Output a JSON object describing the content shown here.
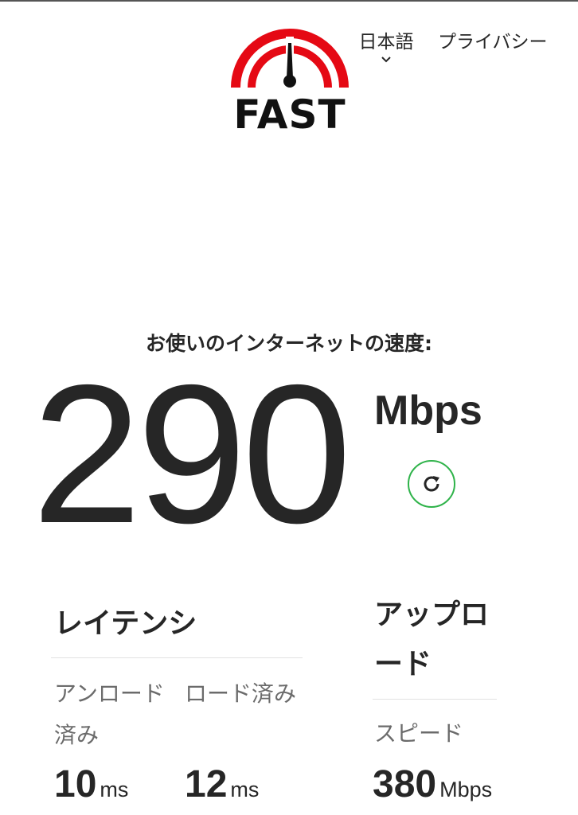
{
  "brand": {
    "logo_text": "FAST",
    "colors": {
      "accent_red": "#e50914",
      "needle": "#111111",
      "refresh_green": "#2fb34a"
    }
  },
  "nav": {
    "language_label": "日本語",
    "language_icon": "chevron-down-icon",
    "privacy_label": "プライバシー"
  },
  "speed": {
    "caption": "お使いのインターネットの速度:",
    "value": "290",
    "units": "Mbps",
    "refresh_icon": "refresh-icon"
  },
  "latency": {
    "title": "レイテンシ",
    "unloaded_label": "アンロード済み",
    "unloaded_value": "10",
    "unloaded_unit": "ms",
    "loaded_label": "ロード済み",
    "loaded_value": "12",
    "loaded_unit": "ms"
  },
  "upload": {
    "title": "アップロード",
    "speed_label": "スピード",
    "value": "380",
    "unit": "Mbps"
  }
}
